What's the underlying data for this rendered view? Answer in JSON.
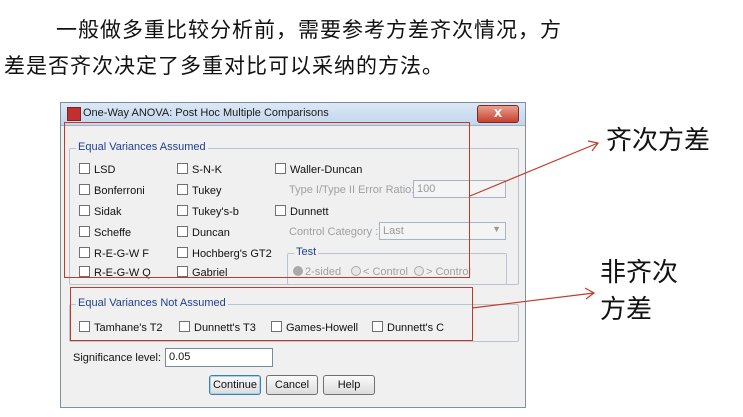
{
  "paragraph": {
    "line1": "一般做多重比较分析前，需要参考方差齐次情况，方",
    "line2": "差是否齐次决定了多重对比可以采纳的方法。"
  },
  "dialog": {
    "title": "One-Way ANOVA: Post Hoc Multiple Comparisons",
    "close_label": "X",
    "equal_assumed": {
      "legend": "Equal Variances Assumed",
      "options": [
        "LSD",
        "S-N-K",
        "Waller-Duncan",
        "Bonferroni",
        "Tukey",
        "Sidak",
        "Tukey's-b",
        "Dunnett",
        "Scheffe",
        "Duncan",
        "R-E-G-W F",
        "Hochberg's GT2",
        "R-E-G-W Q",
        "Gabriel"
      ],
      "error_ratio_label": "Type I/Type II Error Ratio:",
      "error_ratio_value": "100",
      "control_category_label": "Control Category :",
      "control_category_value": "Last",
      "test_legend": "Test",
      "test_options": [
        "2-sided",
        "< Control",
        "> Control"
      ]
    },
    "not_assumed": {
      "legend": "Equal Variances Not Assumed",
      "options": [
        "Tamhane's T2",
        "Dunnett's T3",
        "Games-Howell",
        "Dunnett's C"
      ]
    },
    "significance_label": "Significance level:",
    "significance_value": "0.05",
    "buttons": {
      "continue": "Continue",
      "cancel": "Cancel",
      "help": "Help"
    }
  },
  "annotations": {
    "homogeneous": "齐次方差",
    "heterogeneous_line1": "非齐次",
    "heterogeneous_line2": "方差"
  },
  "colors": {
    "annotation_red": "#c0392b",
    "legend_blue": "#1f3f8f"
  }
}
